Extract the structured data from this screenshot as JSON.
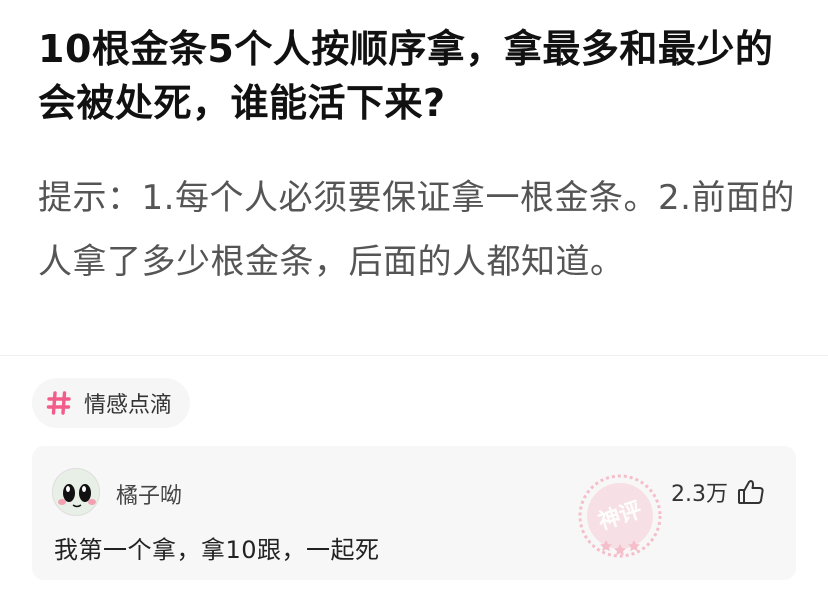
{
  "post": {
    "title": "10根金条5个人按顺序拿，拿最多和最少的会被处死，谁能活下来?",
    "hint": "提示：1.每个人必须要保证拿一根金条。2.前面的人拿了多少根金条，后面的人都知道。"
  },
  "tag": {
    "icon": "hash-icon",
    "label": "情感点滴",
    "color": "#f25c8a"
  },
  "comment": {
    "username": "橘子呦",
    "likes": "2.3万",
    "text": "我第一个拿，拿10跟，一起死",
    "stamp_text": "神评",
    "stamp_color": "#f4a3b5"
  }
}
